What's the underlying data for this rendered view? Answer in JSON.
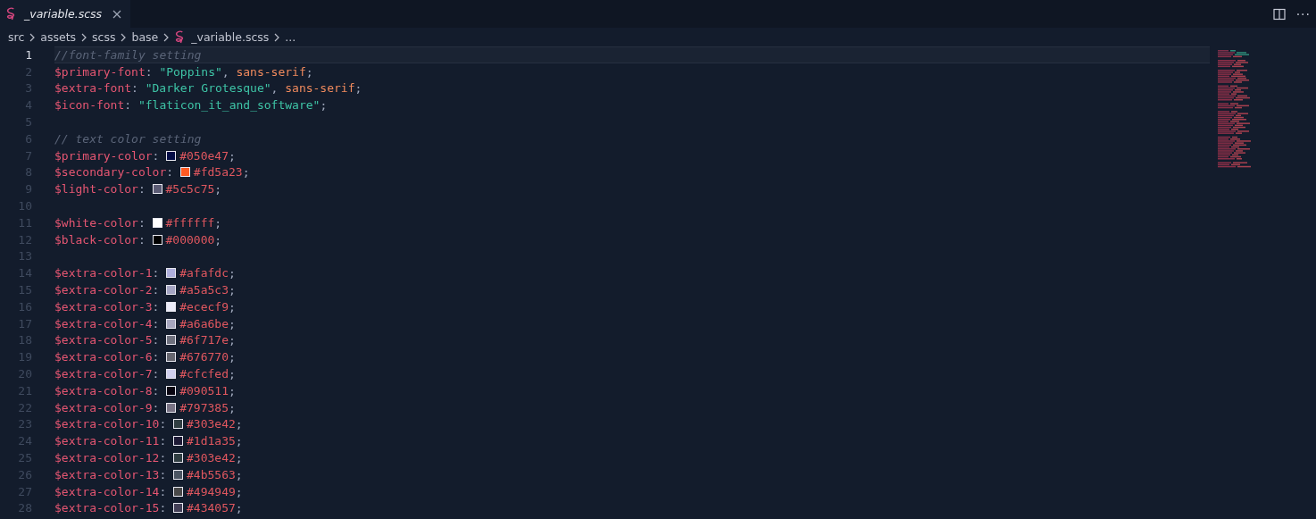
{
  "tab": {
    "title": "_variable.scss",
    "selected": true
  },
  "toolbar": {
    "more": "···"
  },
  "breadcrumbs": [
    "src",
    "assets",
    "scss",
    "base",
    "_variable.scss",
    "..."
  ],
  "lines": [
    {
      "number": "1",
      "current": true,
      "tokens": [
        {
          "kind": "comment",
          "text": "//font-family setting"
        }
      ]
    },
    {
      "number": "2",
      "current": false,
      "tokens": [
        {
          "kind": "variable",
          "text": "$primary-font"
        },
        {
          "kind": "punct",
          "text": ":"
        },
        {
          "kind": "string",
          "text": "\"Poppins\""
        },
        {
          "kind": "punct",
          "text": ","
        },
        {
          "kind": "keyword",
          "text": "sans-serif"
        },
        {
          "kind": "punct",
          "text": ";"
        }
      ]
    },
    {
      "number": "3",
      "current": false,
      "tokens": [
        {
          "kind": "variable",
          "text": "$extra-font"
        },
        {
          "kind": "punct",
          "text": ":"
        },
        {
          "kind": "string",
          "text": "\"Darker Grotesque\""
        },
        {
          "kind": "punct",
          "text": ","
        },
        {
          "kind": "keyword",
          "text": "sans-serif"
        },
        {
          "kind": "punct",
          "text": ";"
        }
      ]
    },
    {
      "number": "4",
      "current": false,
      "tokens": [
        {
          "kind": "variable",
          "text": "$icon-font"
        },
        {
          "kind": "punct",
          "text": ":"
        },
        {
          "kind": "string",
          "text": "\"flaticon_it_and_software\""
        },
        {
          "kind": "punct",
          "text": ";"
        }
      ]
    },
    {
      "number": "5",
      "current": false
    },
    {
      "number": "6",
      "current": false,
      "tokens": [
        {
          "kind": "comment",
          "text": "// text color setting"
        }
      ]
    },
    {
      "number": "7",
      "current": false,
      "tokens": [
        {
          "kind": "variable",
          "text": "$primary-color"
        },
        {
          "kind": "punct",
          "text": ":"
        },
        {
          "kind": "swatch",
          "color": "#050e47"
        },
        {
          "kind": "hex",
          "text": "#050e47"
        },
        {
          "kind": "punct",
          "text": ";"
        }
      ]
    },
    {
      "number": "8",
      "current": false,
      "tokens": [
        {
          "kind": "variable",
          "text": "$secondary-color"
        },
        {
          "kind": "punct",
          "text": ":"
        },
        {
          "kind": "swatch",
          "color": "#fd5a23"
        },
        {
          "kind": "hex",
          "text": "#fd5a23"
        },
        {
          "kind": "punct",
          "text": ";"
        }
      ]
    },
    {
      "number": "9",
      "current": false,
      "tokens": [
        {
          "kind": "variable",
          "text": "$light-color"
        },
        {
          "kind": "punct",
          "text": ":"
        },
        {
          "kind": "swatch",
          "color": "#5c5c75"
        },
        {
          "kind": "hex",
          "text": "#5c5c75"
        },
        {
          "kind": "punct",
          "text": ";"
        }
      ]
    },
    {
      "number": "10",
      "current": false
    },
    {
      "number": "11",
      "current": false,
      "tokens": [
        {
          "kind": "variable",
          "text": "$white-color"
        },
        {
          "kind": "punct",
          "text": ":"
        },
        {
          "kind": "swatch",
          "color": "#ffffff"
        },
        {
          "kind": "hex",
          "text": "#ffffff"
        },
        {
          "kind": "punct",
          "text": ";"
        }
      ]
    },
    {
      "number": "12",
      "current": false,
      "tokens": [
        {
          "kind": "variable",
          "text": "$black-color"
        },
        {
          "kind": "punct",
          "text": ":"
        },
        {
          "kind": "swatch",
          "color": "#000000"
        },
        {
          "kind": "hex",
          "text": "#000000"
        },
        {
          "kind": "punct",
          "text": ";"
        }
      ]
    },
    {
      "number": "13",
      "current": false
    },
    {
      "number": "14",
      "current": false,
      "tokens": [
        {
          "kind": "variable",
          "text": "$extra-color-1"
        },
        {
          "kind": "punct",
          "text": ":"
        },
        {
          "kind": "swatch",
          "color": "#afafdc"
        },
        {
          "kind": "hex",
          "text": "#afafdc"
        },
        {
          "kind": "punct",
          "text": ";"
        }
      ]
    },
    {
      "number": "15",
      "current": false,
      "tokens": [
        {
          "kind": "variable",
          "text": "$extra-color-2"
        },
        {
          "kind": "punct",
          "text": ":"
        },
        {
          "kind": "swatch",
          "color": "#a5a5c3"
        },
        {
          "kind": "hex",
          "text": "#a5a5c3"
        },
        {
          "kind": "punct",
          "text": ";"
        }
      ]
    },
    {
      "number": "16",
      "current": false,
      "tokens": [
        {
          "kind": "variable",
          "text": "$extra-color-3"
        },
        {
          "kind": "punct",
          "text": ":"
        },
        {
          "kind": "swatch",
          "color": "#ececf9"
        },
        {
          "kind": "hex",
          "text": "#ececf9"
        },
        {
          "kind": "punct",
          "text": ";"
        }
      ]
    },
    {
      "number": "17",
      "current": false,
      "tokens": [
        {
          "kind": "variable",
          "text": "$extra-color-4"
        },
        {
          "kind": "punct",
          "text": ":"
        },
        {
          "kind": "swatch",
          "color": "#a6a6be"
        },
        {
          "kind": "hex",
          "text": "#a6a6be"
        },
        {
          "kind": "punct",
          "text": ";"
        }
      ]
    },
    {
      "number": "18",
      "current": false,
      "tokens": [
        {
          "kind": "variable",
          "text": "$extra-color-5"
        },
        {
          "kind": "punct",
          "text": ":"
        },
        {
          "kind": "swatch",
          "color": "#6f717e"
        },
        {
          "kind": "hex",
          "text": "#6f717e"
        },
        {
          "kind": "punct",
          "text": ";"
        }
      ]
    },
    {
      "number": "19",
      "current": false,
      "tokens": [
        {
          "kind": "variable",
          "text": "$extra-color-6"
        },
        {
          "kind": "punct",
          "text": ":"
        },
        {
          "kind": "swatch",
          "color": "#676770"
        },
        {
          "kind": "hex",
          "text": "#676770"
        },
        {
          "kind": "punct",
          "text": ";"
        }
      ]
    },
    {
      "number": "20",
      "current": false,
      "tokens": [
        {
          "kind": "variable",
          "text": "$extra-color-7"
        },
        {
          "kind": "punct",
          "text": ":"
        },
        {
          "kind": "swatch",
          "color": "#cfcfed"
        },
        {
          "kind": "hex",
          "text": "#cfcfed"
        },
        {
          "kind": "punct",
          "text": ";"
        }
      ]
    },
    {
      "number": "21",
      "current": false,
      "tokens": [
        {
          "kind": "variable",
          "text": "$extra-color-8"
        },
        {
          "kind": "punct",
          "text": ":"
        },
        {
          "kind": "swatch",
          "color": "#090511"
        },
        {
          "kind": "hex",
          "text": "#090511"
        },
        {
          "kind": "punct",
          "text": ";"
        }
      ]
    },
    {
      "number": "22",
      "current": false,
      "tokens": [
        {
          "kind": "variable",
          "text": "$extra-color-9"
        },
        {
          "kind": "punct",
          "text": ":"
        },
        {
          "kind": "swatch",
          "color": "#797385"
        },
        {
          "kind": "hex",
          "text": "#797385"
        },
        {
          "kind": "punct",
          "text": ";"
        }
      ]
    },
    {
      "number": "23",
      "current": false,
      "tokens": [
        {
          "kind": "variable",
          "text": "$extra-color-10"
        },
        {
          "kind": "punct",
          "text": ":"
        },
        {
          "kind": "swatch",
          "color": "#303e42"
        },
        {
          "kind": "hex",
          "text": "#303e42"
        },
        {
          "kind": "punct",
          "text": ";"
        }
      ]
    },
    {
      "number": "24",
      "current": false,
      "tokens": [
        {
          "kind": "variable",
          "text": "$extra-color-11"
        },
        {
          "kind": "punct",
          "text": ":"
        },
        {
          "kind": "swatch",
          "color": "#1d1a35"
        },
        {
          "kind": "hex",
          "text": "#1d1a35"
        },
        {
          "kind": "punct",
          "text": ";"
        }
      ]
    },
    {
      "number": "25",
      "current": false,
      "tokens": [
        {
          "kind": "variable",
          "text": "$extra-color-12"
        },
        {
          "kind": "punct",
          "text": ":"
        },
        {
          "kind": "swatch",
          "color": "#303e42"
        },
        {
          "kind": "hex",
          "text": "#303e42"
        },
        {
          "kind": "punct",
          "text": ";"
        }
      ]
    },
    {
      "number": "26",
      "current": false,
      "tokens": [
        {
          "kind": "variable",
          "text": "$extra-color-13"
        },
        {
          "kind": "punct",
          "text": ":"
        },
        {
          "kind": "swatch",
          "color": "#4b5563"
        },
        {
          "kind": "hex",
          "text": "#4b5563"
        },
        {
          "kind": "punct",
          "text": ";"
        }
      ]
    },
    {
      "number": "27",
      "current": false,
      "tokens": [
        {
          "kind": "variable",
          "text": "$extra-color-14"
        },
        {
          "kind": "punct",
          "text": ":"
        },
        {
          "kind": "swatch",
          "color": "#494949"
        },
        {
          "kind": "hex",
          "text": "#494949"
        },
        {
          "kind": "punct",
          "text": ";"
        }
      ]
    },
    {
      "number": "28",
      "current": false,
      "tokens": [
        {
          "kind": "variable",
          "text": "$extra-color-15"
        },
        {
          "kind": "punct",
          "text": ":"
        },
        {
          "kind": "swatch",
          "color": "#434057"
        },
        {
          "kind": "hex",
          "text": "#434057"
        },
        {
          "kind": "punct",
          "text": ";"
        }
      ]
    }
  ]
}
